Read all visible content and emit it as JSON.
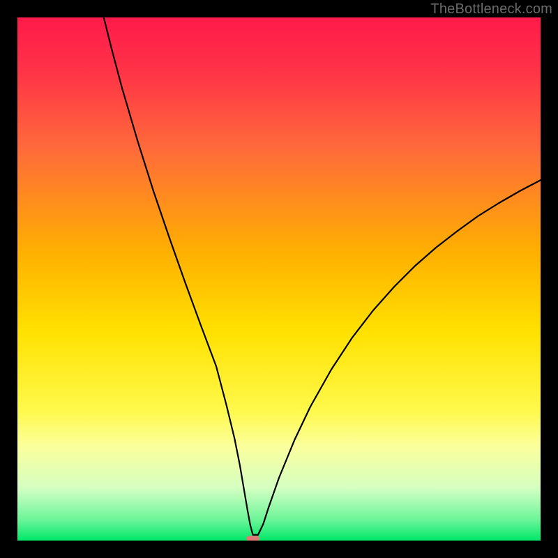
{
  "watermark": "TheBottleneck.com",
  "chart_data": {
    "type": "line",
    "title": "",
    "xlabel": "",
    "ylabel": "",
    "xlim": [
      0,
      100
    ],
    "ylim": [
      0,
      100
    ],
    "grid": false,
    "legend": false,
    "background_gradient": {
      "stops": [
        {
          "pos": 0.0,
          "color": "#ff1a4b"
        },
        {
          "pos": 0.1,
          "color": "#ff3247"
        },
        {
          "pos": 0.25,
          "color": "#ff6a3a"
        },
        {
          "pos": 0.45,
          "color": "#ffb000"
        },
        {
          "pos": 0.6,
          "color": "#ffe100"
        },
        {
          "pos": 0.75,
          "color": "#fff94a"
        },
        {
          "pos": 0.82,
          "color": "#fbff9c"
        },
        {
          "pos": 0.9,
          "color": "#d4ffc2"
        },
        {
          "pos": 0.96,
          "color": "#6cf598"
        },
        {
          "pos": 1.0,
          "color": "#00e86a"
        }
      ]
    },
    "series": [
      {
        "name": "curve",
        "x": [
          16.5,
          18,
          20,
          23,
          26,
          29,
          32,
          35,
          38,
          40,
          41.5,
          42.5,
          43.3,
          44,
          44.5,
          45,
          46,
          47,
          48,
          50,
          53,
          56,
          60,
          64,
          68,
          72,
          76,
          80,
          84,
          88,
          92,
          96,
          100
        ],
        "values": [
          100,
          94,
          86.5,
          76.3,
          66.8,
          58,
          49.5,
          41.3,
          33.3,
          25.7,
          19.5,
          14.5,
          9.8,
          5.7,
          3,
          1.1,
          1.1,
          3.2,
          6.3,
          12,
          19.3,
          25.6,
          32.7,
          38.8,
          44,
          48.5,
          52.5,
          56,
          59.1,
          62,
          64.5,
          66.8,
          68.9
        ]
      }
    ],
    "marker": {
      "name": "target-pill",
      "x": 45.0,
      "y": 0.4,
      "width": 2.5,
      "height": 1.0,
      "color": "#e07878"
    }
  }
}
